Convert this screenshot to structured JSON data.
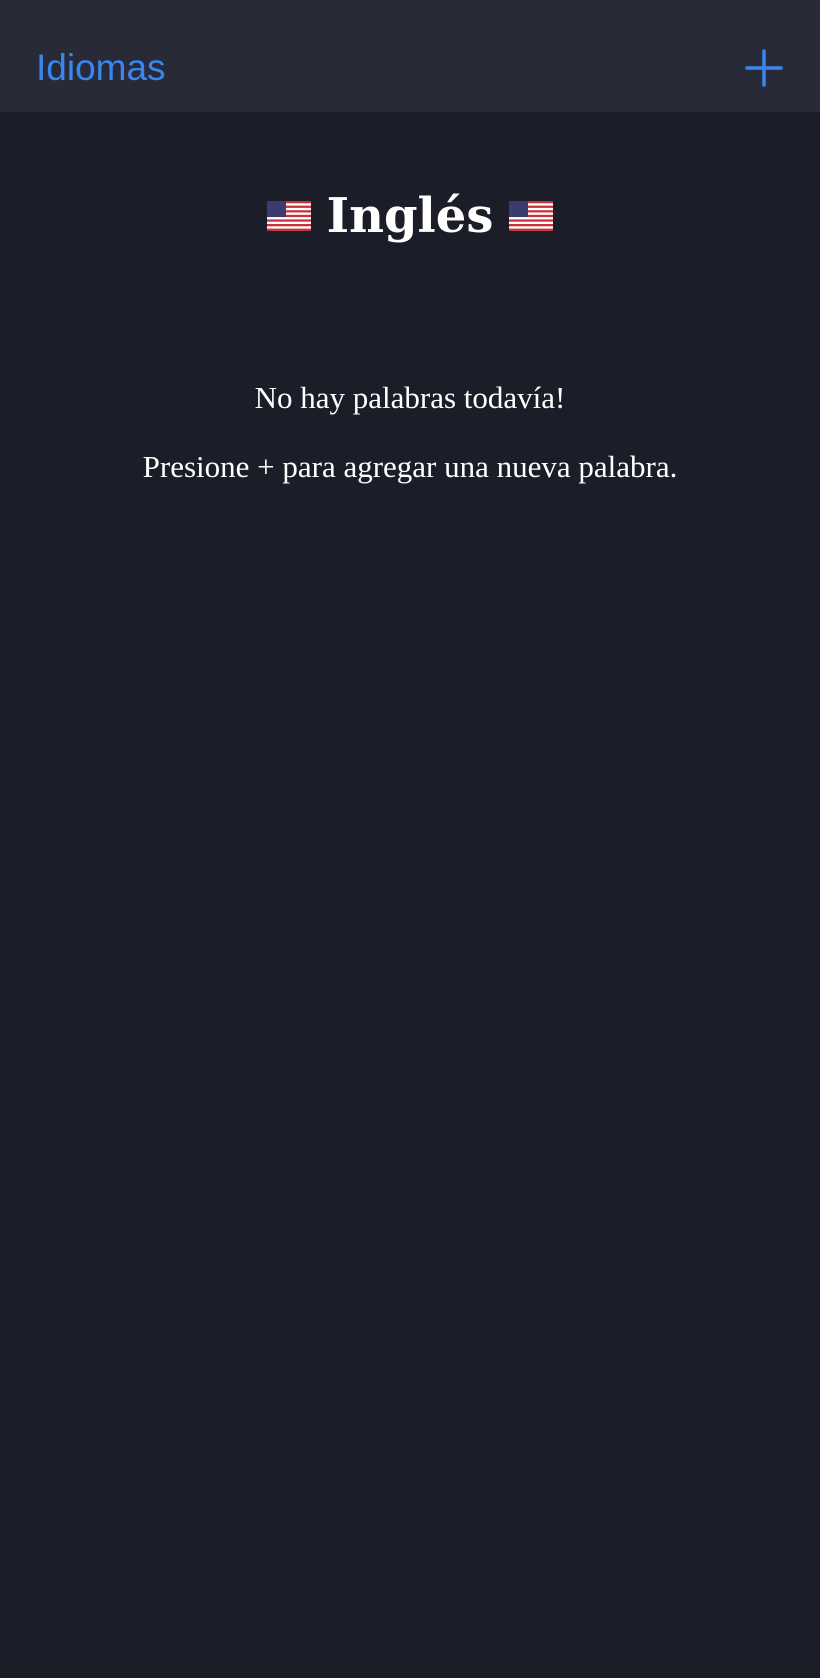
{
  "nav": {
    "back_label": "Idiomas",
    "add_icon": "plus-icon",
    "accent_color": "#3a86f0"
  },
  "language": {
    "name": "Inglés",
    "flag_icon": "us-flag-emoji"
  },
  "empty_state": {
    "line1": "No hay palabras todavía!",
    "line2": "Presione + para agregar una nueva palabra."
  },
  "colors": {
    "background": "#1b1d28",
    "nav_background": "#282a37",
    "text": "#ffffff"
  }
}
